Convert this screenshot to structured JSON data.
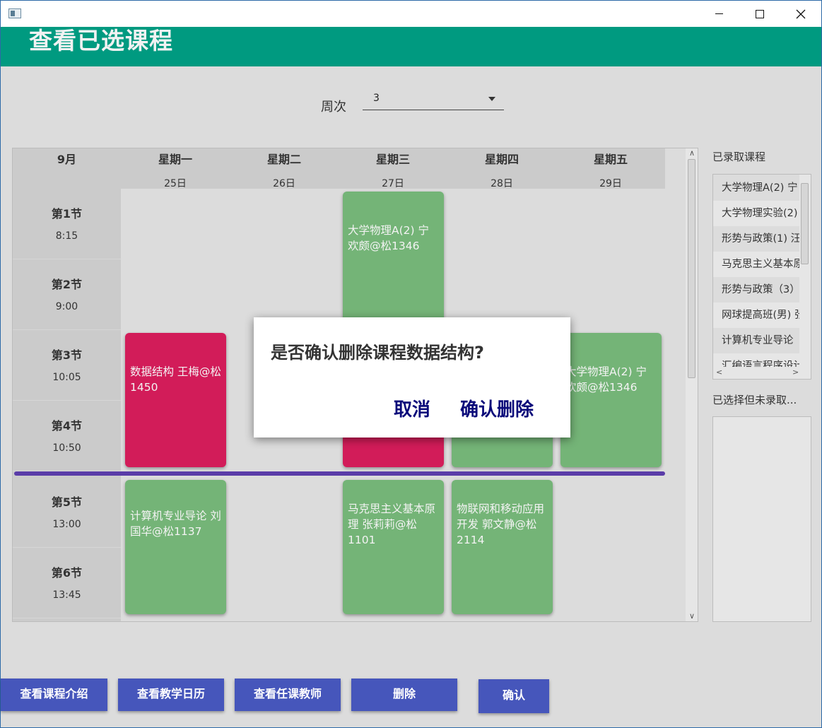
{
  "header": {
    "title": "查看已选课程"
  },
  "week": {
    "label": "周次",
    "value": "3"
  },
  "timetable": {
    "month": "9月",
    "days": [
      {
        "day": "星期一",
        "date": "25日"
      },
      {
        "day": "星期二",
        "date": "26日"
      },
      {
        "day": "星期三",
        "date": "27日"
      },
      {
        "day": "星期四",
        "date": "28日"
      },
      {
        "day": "星期五",
        "date": "29日"
      }
    ],
    "slots": [
      {
        "name": "第1节",
        "time": "8:15"
      },
      {
        "name": "第2节",
        "time": "9:00"
      },
      {
        "name": "第3节",
        "time": "10:05"
      },
      {
        "name": "第4节",
        "time": "10:50"
      },
      {
        "name": "第5节",
        "time": "13:00"
      },
      {
        "name": "第6节",
        "time": "13:45"
      }
    ],
    "courses": [
      {
        "text": "大学物理A(2) 宁欢颇@松1346"
      },
      {
        "text": "数据结构 王梅@松1450"
      },
      {
        "text": ""
      },
      {
        "text": ""
      },
      {
        "text": "大学物理A(2) 宁欢颇@松1346"
      },
      {
        "text": "计算机专业导论 刘国华@松1137"
      },
      {
        "text": "马克思主义基本原理 张莉莉@松1101"
      },
      {
        "text": "物联网和移动应用开发 郭文静@松2114"
      }
    ]
  },
  "sidebar": {
    "enrolled_label": "已录取课程",
    "enrolled": [
      "大学物理A(2) 宁",
      "大学物理实验(2)",
      "形势与政策(1) 汪",
      "马克思主义基本原",
      "形势与政策（3）",
      "网球提高班(男) 张",
      "计算机专业导论",
      "汇编语言程序设计"
    ],
    "pending_label": "已选择但未录取..."
  },
  "buttons": {
    "intro": "查看课程介绍",
    "calendar": "查看教学日历",
    "teacher": "查看任课教师",
    "delete": "删除",
    "confirm": "确认"
  },
  "dialog": {
    "message": "是否确认删除课程数据结构?",
    "cancel": "取消",
    "confirm": "确认删除"
  },
  "colors": {
    "header": "#009a80",
    "course_green": "#74b477",
    "course_red": "#d21c59",
    "button": "#4656bb",
    "divider": "#5a3ca8",
    "dialog_button_text": "#0a0a7a"
  }
}
